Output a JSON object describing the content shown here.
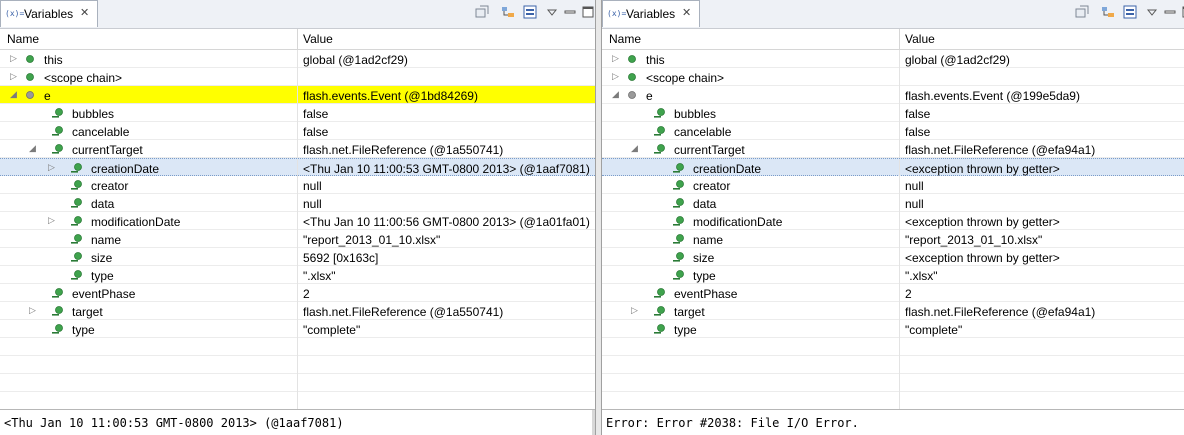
{
  "left": {
    "tab_label": "Variables",
    "tab_icon": "(x)=",
    "columns": {
      "name": "Name",
      "value": "Value"
    },
    "rows": [
      {
        "name": "this",
        "value": "global (@1ad2cf29)",
        "level": 0,
        "expander": "collapsed",
        "icon": "green-dot-icon"
      },
      {
        "name": "<scope chain>",
        "value": "",
        "level": 0,
        "expander": "collapsed",
        "icon": "green-dot-icon"
      },
      {
        "name": "e",
        "value": "flash.events.Event (@1bd84269)",
        "level": 0,
        "expander": "expanded",
        "icon": "gray-dot-icon",
        "highlight": "yellow"
      },
      {
        "name": "bubbles",
        "value": "false",
        "level": 1,
        "expander": "none",
        "icon": "field-icon"
      },
      {
        "name": "cancelable",
        "value": "false",
        "level": 1,
        "expander": "none",
        "icon": "field-icon"
      },
      {
        "name": "currentTarget",
        "value": "flash.net.FileReference (@1a550741)",
        "level": 1,
        "expander": "expanded",
        "icon": "field-icon"
      },
      {
        "name": "creationDate",
        "value": "<Thu Jan 10 11:00:53 GMT-0800 2013> (@1aaf7081)",
        "level": 2,
        "expander": "collapsed",
        "icon": "field-icon",
        "highlight": "select"
      },
      {
        "name": "creator",
        "value": "null",
        "level": 2,
        "expander": "none",
        "icon": "field-icon"
      },
      {
        "name": "data",
        "value": "null",
        "level": 2,
        "expander": "none",
        "icon": "field-icon"
      },
      {
        "name": "modificationDate",
        "value": "<Thu Jan 10 11:00:56 GMT-0800 2013> (@1a01fa01)",
        "level": 2,
        "expander": "collapsed",
        "icon": "field-icon"
      },
      {
        "name": "name",
        "value": "\"report_2013_01_10.xlsx\"",
        "level": 2,
        "expander": "none",
        "icon": "field-icon"
      },
      {
        "name": "size",
        "value": "5692 [0x163c]",
        "level": 2,
        "expander": "none",
        "icon": "field-icon"
      },
      {
        "name": "type",
        "value": "\".xlsx\"",
        "level": 2,
        "expander": "none",
        "icon": "field-icon"
      },
      {
        "name": "eventPhase",
        "value": "2",
        "level": 1,
        "expander": "none",
        "icon": "field-icon"
      },
      {
        "name": "target",
        "value": "flash.net.FileReference (@1a550741)",
        "level": 1,
        "expander": "collapsed",
        "icon": "field-icon"
      },
      {
        "name": "type",
        "value": "\"complete\"",
        "level": 1,
        "expander": "none",
        "icon": "field-icon"
      }
    ],
    "detail_text": "<Thu Jan 10 11:00:53 GMT-0800 2013> (@1aaf7081)"
  },
  "right": {
    "tab_label": "Variables",
    "tab_icon": "(x)=",
    "columns": {
      "name": "Name",
      "value": "Value"
    },
    "rows": [
      {
        "name": "this",
        "value": "global (@1ad2cf29)",
        "level": 0,
        "expander": "collapsed",
        "icon": "green-dot-icon"
      },
      {
        "name": "<scope chain>",
        "value": "",
        "level": 0,
        "expander": "collapsed",
        "icon": "green-dot-icon"
      },
      {
        "name": "e",
        "value": "flash.events.Event (@199e5da9)",
        "level": 0,
        "expander": "expanded",
        "icon": "gray-dot-icon"
      },
      {
        "name": "bubbles",
        "value": "false",
        "level": 1,
        "expander": "none",
        "icon": "field-icon"
      },
      {
        "name": "cancelable",
        "value": "false",
        "level": 1,
        "expander": "none",
        "icon": "field-icon"
      },
      {
        "name": "currentTarget",
        "value": "flash.net.FileReference (@efa94a1)",
        "level": 1,
        "expander": "expanded",
        "icon": "field-icon"
      },
      {
        "name": "creationDate",
        "value": "<exception thrown by getter>",
        "level": 2,
        "expander": "none",
        "icon": "field-icon",
        "highlight": "select"
      },
      {
        "name": "creator",
        "value": "null",
        "level": 2,
        "expander": "none",
        "icon": "field-icon"
      },
      {
        "name": "data",
        "value": "null",
        "level": 2,
        "expander": "none",
        "icon": "field-icon"
      },
      {
        "name": "modificationDate",
        "value": "<exception thrown by getter>",
        "level": 2,
        "expander": "none",
        "icon": "field-icon"
      },
      {
        "name": "name",
        "value": "\"report_2013_01_10.xlsx\"",
        "level": 2,
        "expander": "none",
        "icon": "field-icon"
      },
      {
        "name": "size",
        "value": "<exception thrown by getter>",
        "level": 2,
        "expander": "none",
        "icon": "field-icon"
      },
      {
        "name": "type",
        "value": "\".xlsx\"",
        "level": 2,
        "expander": "none",
        "icon": "field-icon"
      },
      {
        "name": "eventPhase",
        "value": "2",
        "level": 1,
        "expander": "none",
        "icon": "field-icon"
      },
      {
        "name": "target",
        "value": "flash.net.FileReference (@efa94a1)",
        "level": 1,
        "expander": "collapsed",
        "icon": "field-icon"
      },
      {
        "name": "type",
        "value": "\"complete\"",
        "level": 1,
        "expander": "none",
        "icon": "field-icon"
      }
    ],
    "detail_text": "Error: Error #2038: File I/O Error."
  },
  "colors": {
    "highlight_yellow": "#ffff00",
    "selection": "#dbe7f6",
    "green_dot": "#3fa34d",
    "tab_bar": "#eef1f6"
  },
  "toolbar_icons": [
    "show-type-names-icon",
    "collapse-all-icon",
    "layout-icon",
    "view-menu-icon",
    "minimize-icon",
    "maximize-icon"
  ]
}
